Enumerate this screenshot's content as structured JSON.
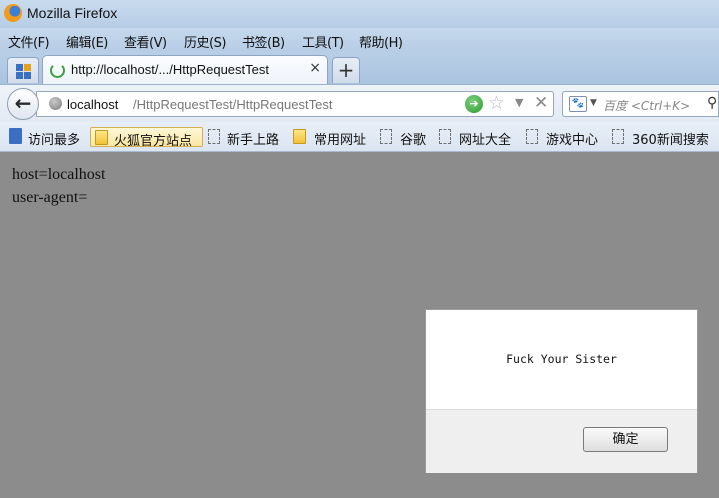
{
  "window": {
    "title": "Mozilla Firefox"
  },
  "menu": [
    "文件(F)",
    "编辑(E)",
    "查看(V)",
    "历史(S)",
    "书签(B)",
    "工具(T)",
    "帮助(H)"
  ],
  "tab": {
    "title": "http://localhost/.../HttpRequestTest",
    "close": "×"
  },
  "new_tab": "+",
  "urlbar": {
    "host": "localhost",
    "path": "/HttpRequestTest/HttpRequestTest"
  },
  "search": {
    "placeholder": "百度 <Ctrl+K>"
  },
  "bookmarks": [
    "访问最多",
    "火狐官方站点",
    "新手上路",
    "常用网址",
    "谷歌",
    "网址大全",
    "游戏中心",
    "360新闻搜索"
  ],
  "content": {
    "line1": "host=localhost",
    "line2": "user-agent="
  },
  "alert": {
    "message": "Fuck Your Sister",
    "ok": "确定"
  },
  "icons": {
    "back": "back-arrow-icon",
    "globe": "globe-icon",
    "go": "go-arrow-icon",
    "star": "bookmark-star-icon",
    "stop": "stop-icon",
    "search": "magnifier-icon"
  }
}
